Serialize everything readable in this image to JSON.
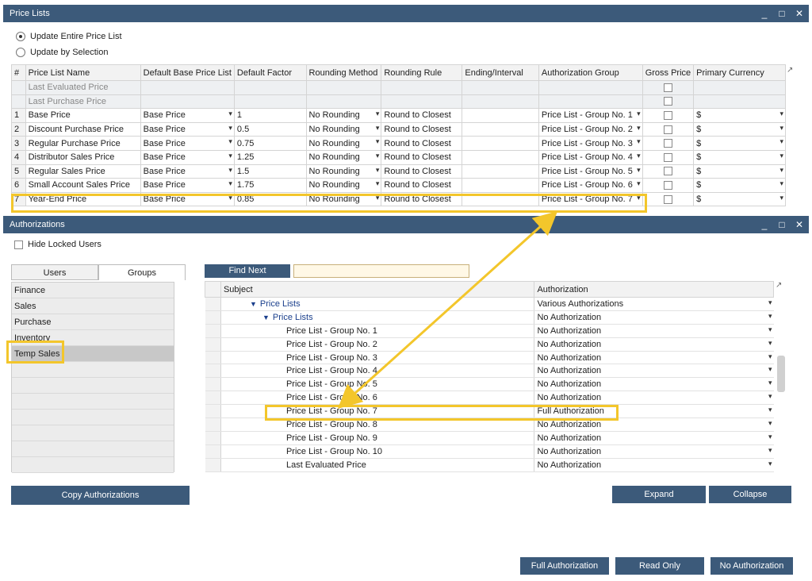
{
  "price_lists_window": {
    "title": "Price Lists",
    "controls": [
      "_",
      "□",
      "✕"
    ],
    "options": [
      {
        "label": "Update Entire Price List",
        "selected": true
      },
      {
        "label": "Update by Selection",
        "selected": false
      }
    ],
    "columns": [
      "#",
      "Price List Name",
      "Default Base Price List",
      "Default Factor",
      "Rounding Method",
      "Rounding Rule",
      "Ending/Interval",
      "Authorization Group",
      "Gross Price",
      "Primary Currency"
    ],
    "gray_rows": [
      {
        "name": "Last Evaluated Price"
      },
      {
        "name": "Last Purchase Price"
      }
    ],
    "rows": [
      {
        "num": "1",
        "name": "Base Price",
        "base": "Base Price",
        "factor": "1",
        "method": "No Rounding",
        "rule": "Round to Closest",
        "interval": "",
        "group": "Price List - Group No. 1",
        "currency": "$"
      },
      {
        "num": "2",
        "name": "Discount Purchase Price",
        "base": "Base Price",
        "factor": "0.5",
        "method": "No Rounding",
        "rule": "Round to Closest",
        "interval": "",
        "group": "Price List - Group No. 2",
        "currency": "$"
      },
      {
        "num": "3",
        "name": "Regular Purchase Price",
        "base": "Base Price",
        "factor": "0.75",
        "method": "No Rounding",
        "rule": "Round to Closest",
        "interval": "",
        "group": "Price List - Group No. 3",
        "currency": "$"
      },
      {
        "num": "4",
        "name": "Distributor Sales Price",
        "base": "Base Price",
        "factor": "1.25",
        "method": "No Rounding",
        "rule": "Round to Closest",
        "interval": "",
        "group": "Price List - Group No. 4",
        "currency": "$"
      },
      {
        "num": "5",
        "name": "Regular Sales Price",
        "base": "Base Price",
        "factor": "1.5",
        "method": "No Rounding",
        "rule": "Round to Closest",
        "interval": "",
        "group": "Price List - Group No. 5",
        "currency": "$"
      },
      {
        "num": "6",
        "name": "Small Account Sales Price",
        "base": "Base Price",
        "factor": "1.75",
        "method": "No Rounding",
        "rule": "Round to Closest",
        "interval": "",
        "group": "Price List - Group No. 6",
        "currency": "$"
      },
      {
        "num": "7",
        "name": "Year-End Price",
        "base": "Base Price",
        "factor": "0.85",
        "method": "No Rounding",
        "rule": "Round to Closest",
        "interval": "",
        "group": "Price List - Group No. 7",
        "currency": "$"
      }
    ]
  },
  "authorizations_window": {
    "title": "Authorizations",
    "controls": [
      "_",
      "□",
      "✕"
    ],
    "hide_locked_label": "Hide Locked Users",
    "tabs": [
      "Users",
      "Groups"
    ],
    "groups": [
      "Finance",
      "Sales",
      "Purchase",
      "Inventory",
      "Temp Sales"
    ],
    "find_next_label": "Find Next",
    "find_value": "",
    "columns": [
      "Subject",
      "Authorization"
    ],
    "tree": [
      {
        "subject": "Price Lists",
        "auth": "Various Authorizations",
        "level": 1
      },
      {
        "subject": "Price Lists",
        "auth": "No Authorization",
        "level": 2
      },
      {
        "subject": "Price List - Group No. 1",
        "auth": "No Authorization",
        "level": 3
      },
      {
        "subject": "Price List - Group No. 2",
        "auth": "No Authorization",
        "level": 3
      },
      {
        "subject": "Price List - Group No. 3",
        "auth": "No Authorization",
        "level": 3
      },
      {
        "subject": "Price List - Group No. 4",
        "auth": "No Authorization",
        "level": 3
      },
      {
        "subject": "Price List - Group No. 5",
        "auth": "No Authorization",
        "level": 3
      },
      {
        "subject": "Price List - Group No. 6",
        "auth": "No Authorization",
        "level": 3
      },
      {
        "subject": "Price List - Group No. 7",
        "auth": "Full Authorization",
        "level": 3
      },
      {
        "subject": "Price List - Group No. 8",
        "auth": "No Authorization",
        "level": 3
      },
      {
        "subject": "Price List - Group No. 9",
        "auth": "No Authorization",
        "level": 3
      },
      {
        "subject": "Price List - Group No. 10",
        "auth": "No Authorization",
        "level": 3
      },
      {
        "subject": "Last Evaluated Price",
        "auth": "No Authorization",
        "level": 3
      }
    ],
    "buttons": {
      "copy": "Copy Authorizations",
      "expand": "Expand",
      "collapse": "Collapse",
      "full": "Full Authorization",
      "read_only": "Read Only",
      "none": "No Authorization"
    }
  },
  "colors": {
    "title_bar": "#3c5a7a",
    "highlight": "#f3c62b"
  }
}
